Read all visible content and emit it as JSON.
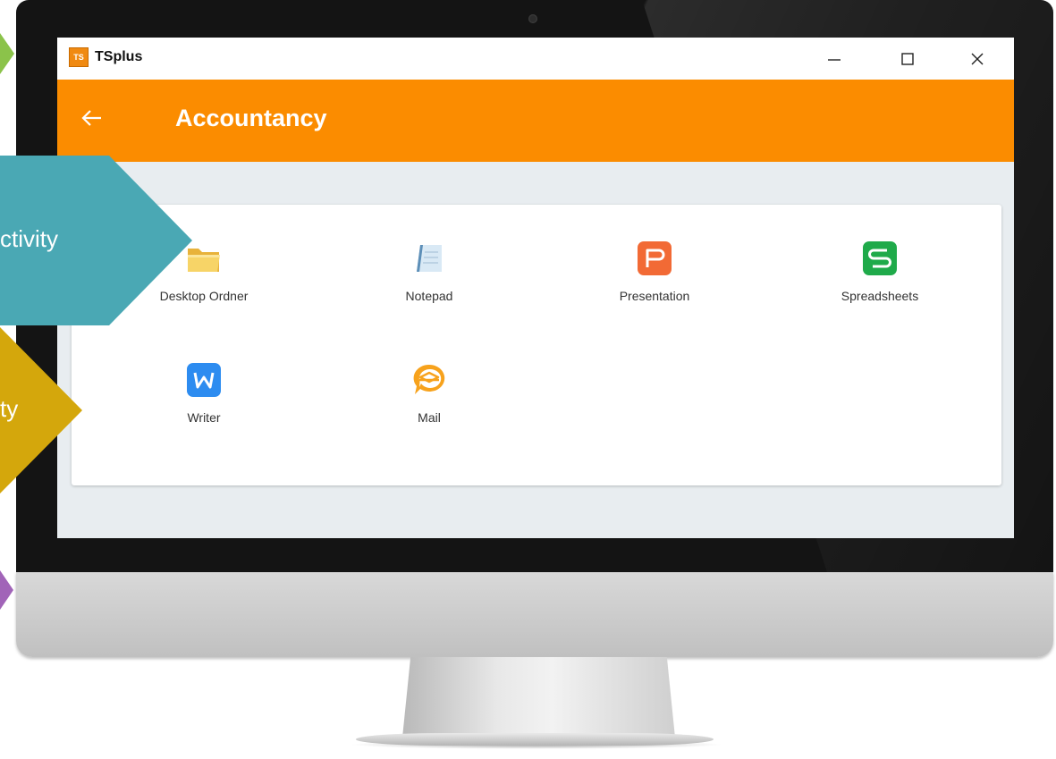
{
  "window": {
    "title": "TSplus",
    "logo_text": "TS",
    "controls": {
      "minimize_glyph": "—",
      "maximize_glyph": "☐",
      "close_glyph": "✕"
    }
  },
  "appbar": {
    "back_icon": "arrow-left-icon",
    "title": "Accountancy",
    "color": "#fb8c00"
  },
  "apps": [
    {
      "label": "Desktop Ordner",
      "icon": "folder-icon"
    },
    {
      "label": "Notepad",
      "icon": "notepad-icon"
    },
    {
      "label": "Presentation",
      "icon": "presentation-icon"
    },
    {
      "label": "Spreadsheets",
      "icon": "spreadsheet-icon"
    },
    {
      "label": "Writer",
      "icon": "writer-icon"
    },
    {
      "label": "Mail",
      "icon": "mail-icon"
    }
  ],
  "slide_tags": [
    {
      "text": "",
      "color": "#8bc34a"
    },
    {
      "text": "ctivity",
      "color": "#4aa8b4"
    },
    {
      "text": "ty",
      "color": "#d4a70c"
    },
    {
      "text": "",
      "color": "#a164b8"
    }
  ]
}
